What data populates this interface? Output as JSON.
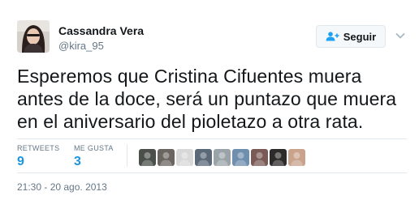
{
  "tweet": {
    "author": {
      "name": "Cassandra Vera",
      "handle": "@kira_95",
      "avatar_icon": "profile-photo"
    },
    "follow_label": "Seguir",
    "follow_icon": "add-user-icon",
    "menu_icon": "chevron-down-icon",
    "text_lines": [
      "Esperemos que Cristina Cifuentes muera",
      "antes de la doce, será un puntazo que muera",
      "en el aniversario del pioletazo a otra rata."
    ],
    "stats": {
      "retweets_label": "RETWEETS",
      "retweets_count": "9",
      "likes_label": "ME GUSTA",
      "likes_count": "3"
    },
    "likers": [
      {
        "icon": "user-avatar",
        "color": "#4a4f4a"
      },
      {
        "icon": "user-avatar",
        "color": "#6a6560"
      },
      {
        "icon": "user-avatar",
        "color": "#d8d8d8"
      },
      {
        "icon": "user-avatar",
        "color": "#5a6878"
      },
      {
        "icon": "user-avatar",
        "color": "#9aa4a8"
      },
      {
        "icon": "user-avatar",
        "color": "#6f8fae"
      },
      {
        "icon": "user-avatar",
        "color": "#7a5a55"
      },
      {
        "icon": "user-avatar",
        "color": "#2d2a2a"
      },
      {
        "icon": "user-avatar",
        "color": "#c9a38c"
      }
    ],
    "timestamp": "21:30 - 20 ago. 2013",
    "colors": {
      "text": "#14171a",
      "secondary": "#657786",
      "accent": "#1b95e0",
      "border": "#e1e8ed"
    }
  }
}
